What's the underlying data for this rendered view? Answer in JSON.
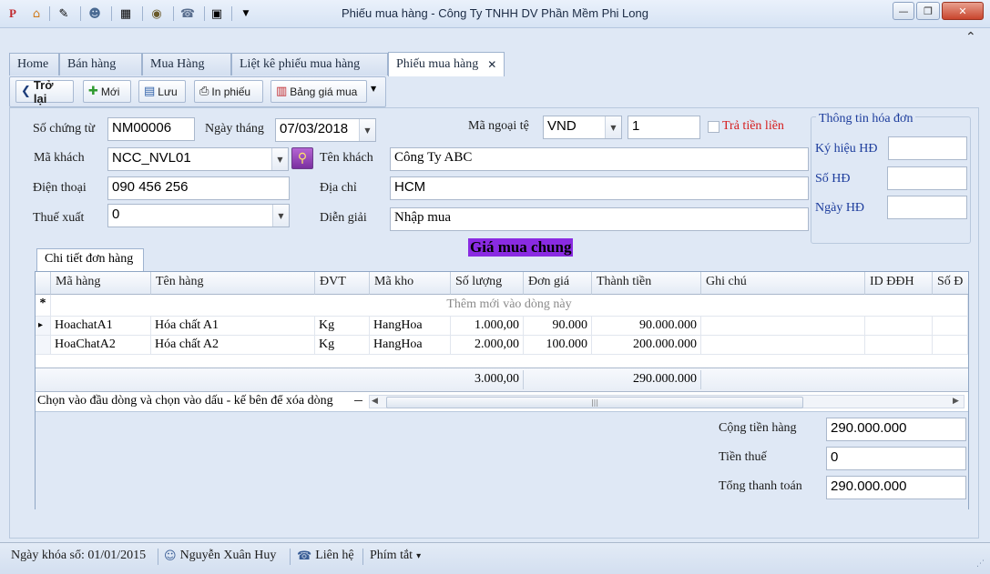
{
  "window": {
    "title": "Phiếu mua hàng - Công Ty TNHH DV Phần Mềm Phi Long",
    "quick_access_icons": [
      "app-logo-icon",
      "home-icon",
      "tools-icon",
      "users-icon",
      "film-icon",
      "eye-icon",
      "phone-icon",
      "calculator-icon",
      "dropdown-icon"
    ],
    "controls": {
      "minimize": "—",
      "restore": "❐",
      "close": "✕"
    },
    "collapse_glyph": "⌃"
  },
  "tabs": [
    {
      "label": "Home"
    },
    {
      "label": "Bán hàng"
    },
    {
      "label": "Mua Hàng"
    },
    {
      "label": "Liệt kê phiếu mua hàng"
    },
    {
      "label": "Phiếu mua hàng",
      "close": "✕"
    }
  ],
  "toolbar": {
    "back_label": "Trở lại",
    "new_label": "Mới",
    "save_label": "Lưu",
    "print_label": "In phiếu",
    "price_label": "Bảng giá mua"
  },
  "form": {
    "voucher_no_label": "Số chứng từ",
    "voucher_no": "NM00006",
    "date_label": "Ngày tháng",
    "date": "07/03/2018",
    "currency_label": "Mã ngoại tệ",
    "currency": "VND",
    "rate": "1",
    "pay_now_label": "Trả tiền liền",
    "customer_code_label": "Mã khách",
    "customer_code": "NCC_NVL01",
    "customer_name_label": "Tên khách",
    "customer_name": "Công Ty ABC",
    "phone_label": "Điện thoại",
    "phone": "090 456 256",
    "address_label": "Địa chỉ",
    "address": "HCM",
    "tax_label": "Thuế xuất",
    "tax": "0",
    "note_label": "Diễn giải",
    "note": "Nhập mua"
  },
  "invoice": {
    "group_title": "Thông tin hóa đơn",
    "symbol_label": "Ký hiệu HĐ",
    "number_label": "Số HĐ",
    "date_label": "Ngày HĐ",
    "symbol": "",
    "number": "",
    "date": ""
  },
  "price_banner": "Giá mua chung",
  "detail": {
    "tab_label": "Chi tiết đơn hàng",
    "columns": [
      "Mã hàng",
      "Tên hàng",
      "ĐVT",
      "Mã kho",
      "Số lượng",
      "Đơn giá",
      "Thành tiền",
      "Ghi chú",
      "ID ĐĐH",
      "Số Đ"
    ],
    "new_row_text": "Thêm mới vào dòng này",
    "new_row_marker": "*",
    "current_row_marker": "▸",
    "rows": [
      {
        "code": "HoachatA1",
        "name": "Hóa chất A1",
        "unit": "Kg",
        "warehouse": "HangHoa",
        "qty": "1.000,00",
        "price": "90.000",
        "amount": "90.000.000"
      },
      {
        "code": "HoaChatA2",
        "name": "Hóa chất A2",
        "unit": "Kg",
        "warehouse": "HangHoa",
        "qty": "2.000,00",
        "price": "100.000",
        "amount": "200.000.000"
      }
    ],
    "sum_qty": "3.000,00",
    "sum_amount": "290.000.000",
    "hint": "Chọn vào đầu dòng và chọn vào dấu - kế bên để xóa dòng",
    "scroll_left": "◀",
    "scroll_right": "▶",
    "scroll_grip": "|||"
  },
  "totals": {
    "subtotal_label": "Cộng tiền hàng",
    "subtotal": "290.000.000",
    "tax_label": "Tiền thuế",
    "tax": "0",
    "total_label": "Tổng thanh toán",
    "total": "290.000.000"
  },
  "status": {
    "lock_date": "Ngày khóa sổ: 01/01/2015",
    "user": "Nguyễn Xuân Huy",
    "contact": "Liên hệ",
    "shortcuts": "Phím tắt",
    "shortcuts_arrow": "▾"
  }
}
